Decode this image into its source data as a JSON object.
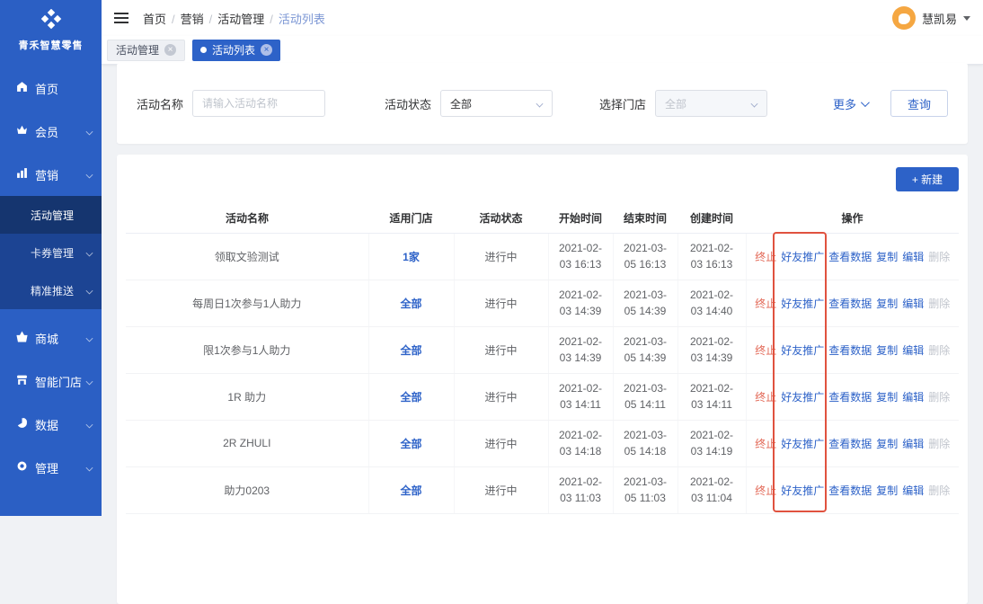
{
  "colors": {
    "sidebar_blue": "#2b5fc4",
    "submenu_blue": "#1c4493",
    "active_item_blue": "#15356f",
    "primary_blue": "#2d62c8",
    "terminate_red": "#e26553",
    "annotation_red": "#e0523f",
    "avatar_orange": "#f5a742"
  },
  "sidebar": {
    "brand": "青禾智慧零售",
    "items": [
      {
        "label": "首页",
        "icon": "home-icon"
      },
      {
        "label": "会员",
        "icon": "crown-icon"
      },
      {
        "label": "营销",
        "icon": "chart-icon",
        "children": [
          "活动管理",
          "卡券管理",
          "精准推送"
        ]
      },
      {
        "label": "商城",
        "icon": "basket-icon"
      },
      {
        "label": "智能门店",
        "icon": "storefront-icon"
      },
      {
        "label": "数据",
        "icon": "pie-icon"
      },
      {
        "label": "管理",
        "icon": "gear-icon"
      }
    ]
  },
  "header": {
    "breadcrumb": [
      "首页",
      "营销",
      "活动管理",
      "活动列表"
    ],
    "user_name": "慧凯易"
  },
  "tabs": [
    {
      "label": "活动管理",
      "active": false
    },
    {
      "label": "活动列表",
      "active": true
    }
  ],
  "filters": {
    "name_label": "活动名称",
    "name_placeholder": "请输入活动名称",
    "status_label": "活动状态",
    "status_value": "全部",
    "store_label": "选择门店",
    "store_value": "全部",
    "more_label": "更多",
    "search_label": "查询"
  },
  "toolbar": {
    "create_label": "+ 新建"
  },
  "table": {
    "headers": [
      "活动名称",
      "适用门店",
      "活动状态",
      "开始时间",
      "结束时间",
      "创建时间",
      "操作"
    ],
    "op_labels": [
      "终止",
      "好友推广",
      "查看数据",
      "复制",
      "编辑",
      "删除"
    ],
    "rows": [
      {
        "name": "领取文验测试",
        "store": "1家",
        "status": "进行中",
        "start": "2021-02-03 16:13",
        "end": "2021-03-05 16:13",
        "created": "2021-02-03 16:13"
      },
      {
        "name": "每周日1次参与1人助力",
        "store": "全部",
        "status": "进行中",
        "start": "2021-02-03 14:39",
        "end": "2021-03-05 14:39",
        "created": "2021-02-03 14:40"
      },
      {
        "name": "限1次参与1人助力",
        "store": "全部",
        "status": "进行中",
        "start": "2021-02-03 14:39",
        "end": "2021-03-05 14:39",
        "created": "2021-02-03 14:39"
      },
      {
        "name": "1R 助力",
        "store": "全部",
        "status": "进行中",
        "start": "2021-02-03 14:11",
        "end": "2021-03-05 14:11",
        "created": "2021-02-03 14:11"
      },
      {
        "name": "2R ZHULI",
        "store": "全部",
        "status": "进行中",
        "start": "2021-02-03 14:18",
        "end": "2021-03-05 14:18",
        "created": "2021-02-03 14:19"
      },
      {
        "name": "助力0203",
        "store": "全部",
        "status": "进行中",
        "start": "2021-02-03 11:03",
        "end": "2021-03-05 11:03",
        "created": "2021-02-03 11:04"
      }
    ]
  }
}
